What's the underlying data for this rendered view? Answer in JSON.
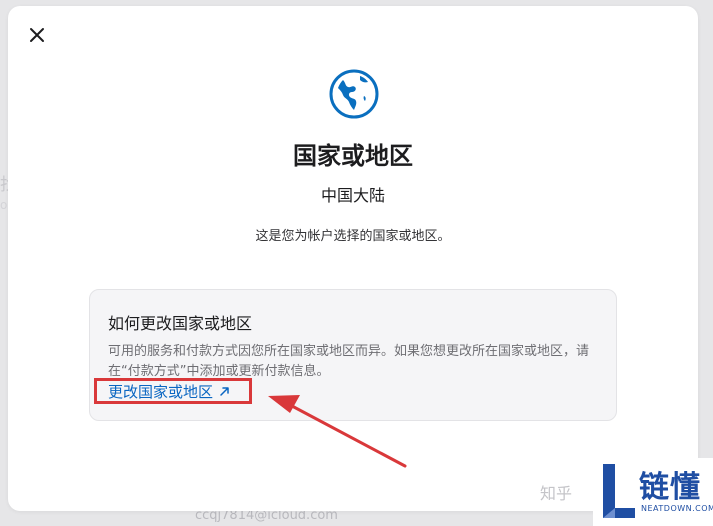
{
  "background": {
    "left_fragment_1": "找",
    "left_fragment_2": "o",
    "bottom_fragment": "ccqj7814@icloud.com"
  },
  "modal": {
    "close_icon": "close-icon",
    "globe_icon": "globe-icon",
    "title": "国家或地区",
    "current_region": "中国大陆",
    "description": "这是您为帐户选择的国家或地区。",
    "info_card": {
      "title": "如何更改国家或地区",
      "body": "可用的服务和付款方式因您所在国家或地区而异。如果您想更改所在国家或地区，请在“付款方式”中添加或更新付款信息。",
      "link_label": "更改国家或地区",
      "link_icon": "external-arrow-icon"
    }
  },
  "watermark": {
    "zhihu": "知乎",
    "brand": "链懂",
    "brand_sub": "NEATDOWN.COM"
  },
  "colors": {
    "accent_blue": "#0a66c2",
    "globe_blue": "#0a6fbf",
    "highlight_red": "#d9383a"
  }
}
